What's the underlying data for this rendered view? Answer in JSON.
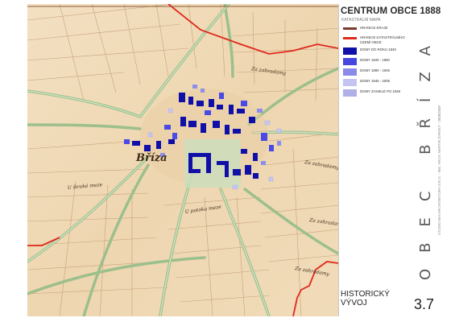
{
  "header": {
    "title": "CENTRUM OBCE 1888",
    "subtitle": "KATASTRÁLNÍ MAPA"
  },
  "legend": [
    {
      "label": "HRANICE KRAJE",
      "kind": "line",
      "color": "#7a3b2e"
    },
    {
      "label": "HRANICE KATASTRÁLNÍHO\nÚZEMÍ OBCE",
      "kind": "line",
      "color": "#e0281c"
    },
    {
      "label": "DOMY DO ROKU 1840",
      "kind": "box",
      "color": "#1010a8"
    },
    {
      "label": "DOMY 1840 - 1890",
      "kind": "box",
      "color": "#4646e0"
    },
    {
      "label": "DOMY 1890 - 1949",
      "kind": "box",
      "color": "#8a8ae8"
    },
    {
      "label": "DOMY 1945 - 2008",
      "kind": "box",
      "color": "#c4c4f2"
    },
    {
      "label": "DOMY ZANIKLÉ PO 1948",
      "kind": "box",
      "color": "#b0b0e8"
    }
  ],
  "side": {
    "vertical_title": "OBEC BŘÍZA",
    "vertical_credits": "STUDIO MAI-ARCHITEKTURA S.R.O. - ING. ARCH. MARTIN ŽARSKÝ - 2008/2009"
  },
  "footer": {
    "section_title_line1": "HISTORICKÝ",
    "section_title_line2": "VÝVOJ",
    "page_number": "3.7"
  },
  "map": {
    "village_label": "Bříza",
    "field_labels": [
      "Za zahradamy",
      "Za zahradamy",
      "U široké meze",
      "U potoka meze",
      "Za zahradamy",
      "Za zahradamy"
    ],
    "colors": {
      "paper": "#f1dcbb",
      "road": "#b9d2a8",
      "road_edge": "#7fa070",
      "boundary": "#e0281c",
      "parcel": "#c9a57e"
    }
  }
}
